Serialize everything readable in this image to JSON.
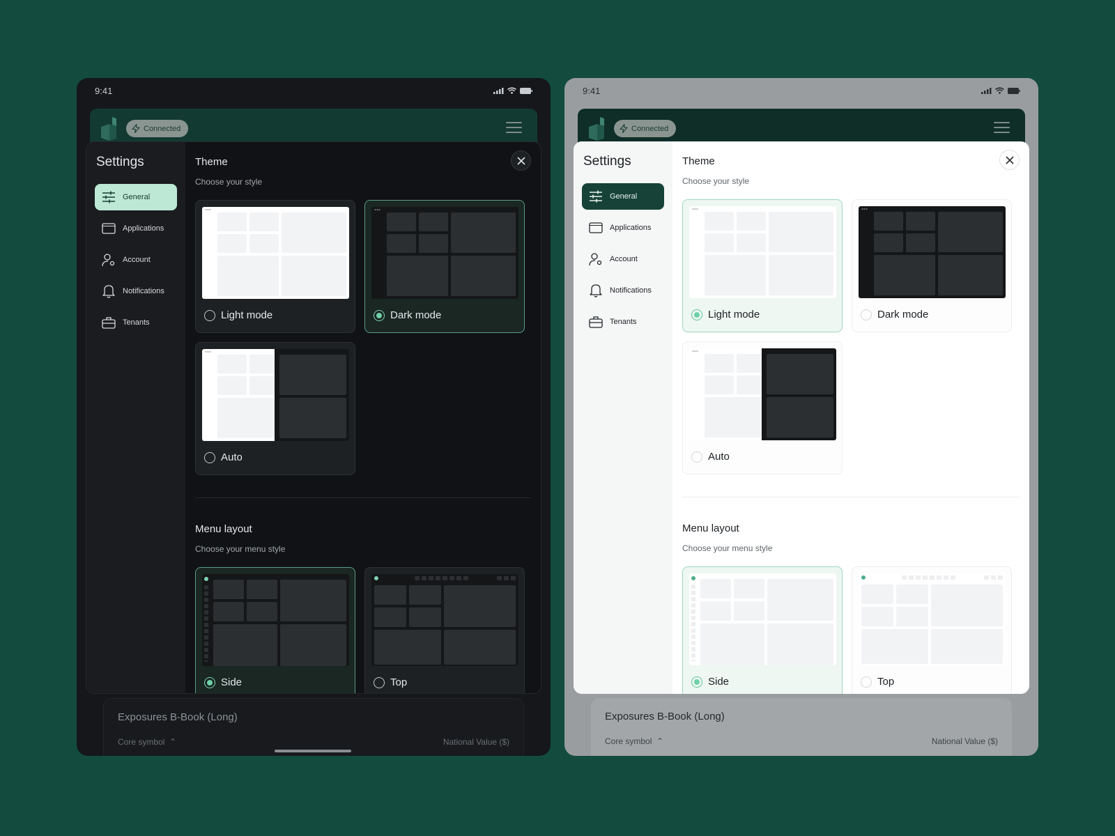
{
  "status": {
    "time": "9:41"
  },
  "header": {
    "connected_label": "Connected"
  },
  "settings": {
    "title": "Settings",
    "nav": [
      {
        "label": "General",
        "icon": "sliders-icon"
      },
      {
        "label": "Applications",
        "icon": "window-icon"
      },
      {
        "label": "Account",
        "icon": "user-gear-icon"
      },
      {
        "label": "Notifications",
        "icon": "bell-icon"
      },
      {
        "label": "Tenants",
        "icon": "briefcase-icon"
      }
    ],
    "theme": {
      "title": "Theme",
      "subtitle": "Choose your style",
      "options": [
        "Light mode",
        "Dark mode",
        "Auto"
      ]
    },
    "menu_layout": {
      "title": "Menu layout",
      "subtitle": "Choose your menu style",
      "options": [
        "Side",
        "Top"
      ]
    }
  },
  "dark_screen": {
    "selected_theme": "Dark mode",
    "selected_menu": "Side"
  },
  "light_screen": {
    "selected_theme": "Light mode",
    "selected_menu": "Side"
  },
  "background": {
    "card_title": "Exposures B-Book (Long)",
    "col_left": "Core symbol",
    "col_right": "National Value ($)"
  },
  "colors": {
    "backdrop": "#134c3e",
    "accent": "#6fd1a8",
    "active_nav_dark": "#bde8d5",
    "active_nav_light": "#174237"
  }
}
